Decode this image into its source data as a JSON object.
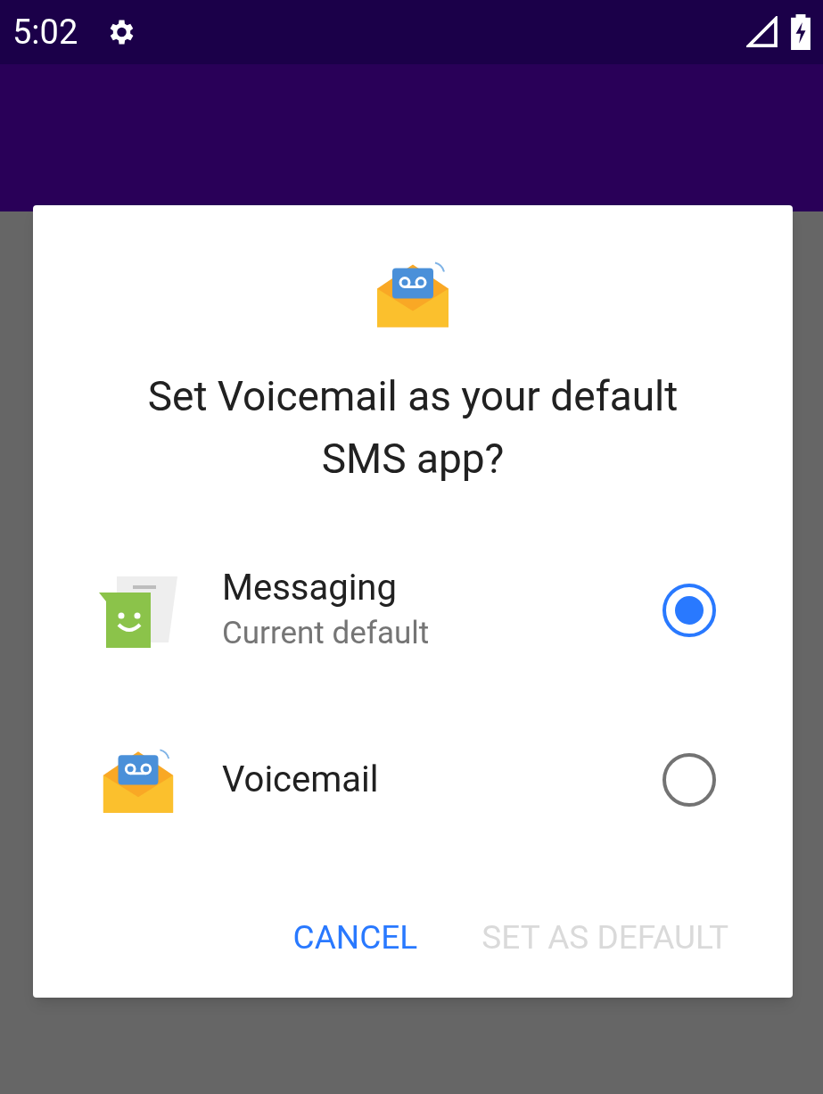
{
  "status_bar": {
    "time": "5:02"
  },
  "dialog": {
    "title": "Set Voicemail as your default SMS app?",
    "options": [
      {
        "name": "Messaging",
        "subtitle": "Current default",
        "kind": "messaging",
        "selected": true
      },
      {
        "name": "Voicemail",
        "kind": "voicemail",
        "selected": false
      }
    ],
    "buttons": [
      {
        "label": "CANCEL",
        "disabled": false
      },
      {
        "label": "SET AS DEFAULT",
        "disabled": true
      }
    ]
  }
}
